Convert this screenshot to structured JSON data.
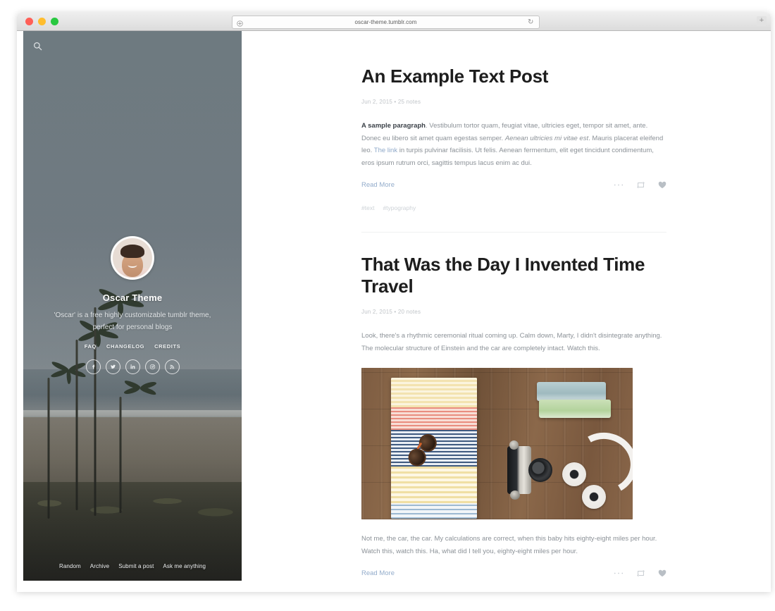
{
  "browser": {
    "url": "oscar-theme.tumblr.com",
    "traffic_lights": [
      "close",
      "minimize",
      "maximize"
    ],
    "reload_icon": "reload-icon",
    "site_settings_icon": "site-settings-icon",
    "new_tab_label": "+"
  },
  "sidebar": {
    "search_icon": "search-icon",
    "avatar": "avatar-portrait",
    "blog_title": "Oscar Theme",
    "description": "'Oscar' is a free highly customizable tumblr theme, perfect for personal blogs",
    "mini_links": [
      {
        "label": "FAQ"
      },
      {
        "label": "CHANGELOG"
      },
      {
        "label": "CREDITS"
      }
    ],
    "socials": [
      {
        "name": "facebook-icon",
        "glyph": "f"
      },
      {
        "name": "twitter-icon",
        "glyph": "t"
      },
      {
        "name": "linkedin-icon",
        "glyph": "in"
      },
      {
        "name": "dribbble-icon",
        "glyph": "d"
      },
      {
        "name": "rss-icon",
        "glyph": "r"
      }
    ],
    "bottom_nav": [
      {
        "label": "Random"
      },
      {
        "label": "Archive"
      },
      {
        "label": "Submit a post"
      },
      {
        "label": "Ask me anything"
      }
    ]
  },
  "posts": [
    {
      "title": "An Example Text Post",
      "date": "Jun 2, 2015",
      "notes": "25 notes",
      "meta": "Jun 2, 2015 • 25 notes",
      "body_lead": "A sample paragraph",
      "body_part1": ". Vestibulum tortor quam, feugiat vitae, ultricies eget, tempor sit amet, ante. Donec eu libero sit amet quam egestas semper. ",
      "body_italic": "Aenean ultricies mi vitae est",
      "body_part2": ". Mauris placerat eleifend leo. ",
      "body_link": "The link",
      "body_part3": " in turpis pulvinar facilisis. Ut felis. Aenean fermentum, elit eget tincidunt condimentum, eros ipsum rutrum orci, sagittis tempus lacus enim ac dui.",
      "read_more": "Read More",
      "actions": [
        "ellipsis-icon",
        "reblog-icon",
        "like-icon"
      ],
      "tags": [
        "#text",
        "#typography"
      ]
    },
    {
      "title": "That Was the Day I Invented Time Travel",
      "date": "Jun 2, 2015",
      "notes": "20 notes",
      "meta": "Jun 2, 2015 • 20 notes",
      "body_top": "Look, there's a rhythmic ceremonial ritual coming up. Calm down, Marty, I didn't disintegrate anything. The molecular structure of Einstein and the car are completely intact. Watch this.",
      "image_alt": "flat-lay-travel-essentials-photo",
      "body_bottom": "Not me, the car, the car. My calculations are correct, when this baby hits eighty-eight miles per hour. Watch this, watch this. Ha, what did I tell you, eighty-eight miles per hour.",
      "read_more": "Read More",
      "actions": [
        "ellipsis-icon",
        "reblog-icon",
        "like-icon"
      ]
    }
  ],
  "colors": {
    "link": "#8fa9c9",
    "text": "#8b9197",
    "heading": "#1d1d1d",
    "meta": "#c1c5c9",
    "sidebar_base": "#6e7b80"
  }
}
